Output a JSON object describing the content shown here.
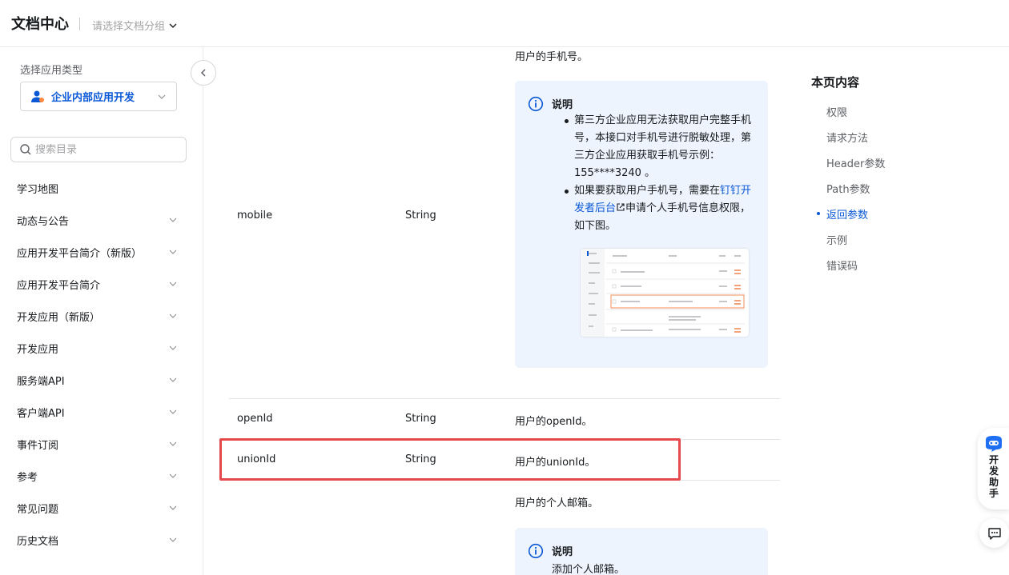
{
  "header": {
    "title": "文档中心",
    "group_placeholder": "请选择文档分组"
  },
  "sidebar": {
    "app_type_label": "选择应用类型",
    "app_type_value": "企业内部应用开发",
    "search_placeholder": "搜索目录",
    "items": [
      {
        "label": "学习地图",
        "expandable": false
      },
      {
        "label": "动态与公告",
        "expandable": true
      },
      {
        "label": "应用开发平台简介（新版）",
        "expandable": true
      },
      {
        "label": "应用开发平台简介",
        "expandable": true
      },
      {
        "label": "开发应用（新版）",
        "expandable": true
      },
      {
        "label": "开发应用",
        "expandable": true
      },
      {
        "label": "服务端API",
        "expandable": true
      },
      {
        "label": "客户端API",
        "expandable": true
      },
      {
        "label": "事件订阅",
        "expandable": true
      },
      {
        "label": "参考",
        "expandable": true
      },
      {
        "label": "常见问题",
        "expandable": true
      },
      {
        "label": "历史文档",
        "expandable": true
      }
    ]
  },
  "table": {
    "mobile": {
      "name": "mobile",
      "type": "String",
      "desc": "用户的手机号。",
      "note": {
        "title": "说明",
        "bullet1": "第三方企业应用无法获取用户完整手机号，本接口对手机号进行脱敏处理，第三方企业应用获取手机号示例：  155****3240 。",
        "bullet2_pre": "如果要获取用户手机号，需要在",
        "bullet2_link": "钉钉开发者后台",
        "bullet2_post": "申请个人手机号信息权限，如下图。"
      }
    },
    "openId": {
      "name": "openId",
      "type": "String",
      "desc": "用户的openId。"
    },
    "unionId": {
      "name": "unionId",
      "type": "String",
      "desc": "用户的unionId。"
    },
    "email": {
      "desc": "用户的个人邮箱。",
      "note": {
        "title": "说明",
        "text": "添加个人邮箱。"
      }
    }
  },
  "toc": {
    "title": "本页内容",
    "items": [
      "权限",
      "请求方法",
      "Header参数",
      "Path参数",
      "返回参数",
      "示例",
      "错误码"
    ],
    "active_index": 4
  },
  "assistant": {
    "label": "开发助手"
  },
  "colors": {
    "accent": "#0a58d6",
    "highlight": "#e5484d",
    "note_bg": "#edf4fe"
  }
}
